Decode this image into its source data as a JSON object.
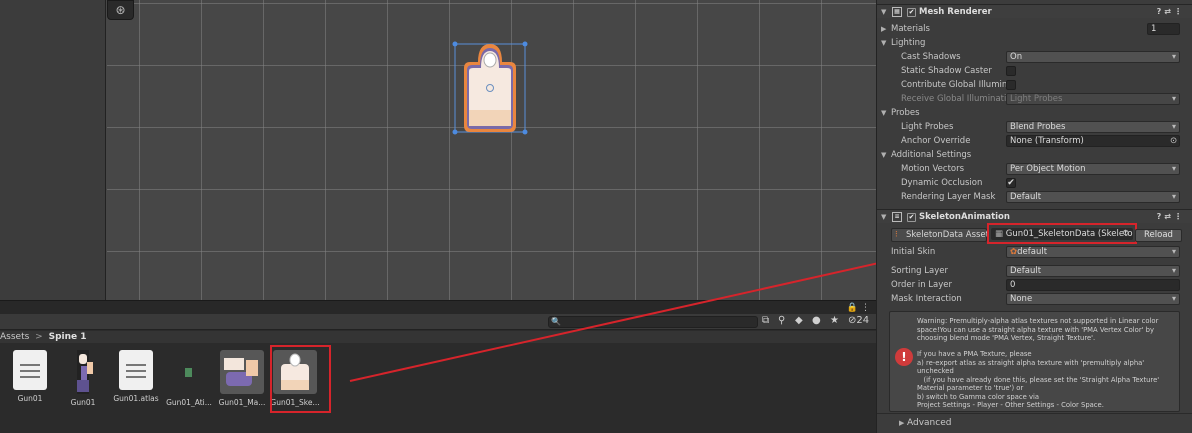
{
  "scene": {
    "gizmo_icon": "globe-grid-icon",
    "panel_icons": "🔒 ⋮"
  },
  "project": {
    "breadcrumb": {
      "root": "Assets",
      "sep": ">",
      "folder": "Spine 1"
    },
    "toolbar": {
      "hidden_count": "24"
    },
    "assets": [
      {
        "label": "Gun01",
        "icon": "text-file-icon"
      },
      {
        "label": "Gun01",
        "icon": "atlas-texture-icon"
      },
      {
        "label": "Gun01.atlas",
        "icon": "text-file-icon"
      },
      {
        "label": "Gun01_Ati...",
        "icon": "atlas-asset-icon"
      },
      {
        "label": "Gun01_Ma...",
        "icon": "material-icon"
      },
      {
        "label": "Gun01_Ske...",
        "icon": "skeleton-data-icon"
      }
    ]
  },
  "inspector": {
    "mesh_renderer": {
      "title": "Mesh Renderer",
      "materials_label": "Materials",
      "materials_count": "1",
      "lighting_label": "Lighting",
      "cast_shadows_label": "Cast Shadows",
      "cast_shadows_value": "On",
      "static_shadow_label": "Static Shadow Caster",
      "contribute_gi_label": "Contribute Global Illuminat",
      "receive_gi_label": "Receive Global Illumination",
      "receive_gi_value": "Light Probes",
      "probes_label": "Probes",
      "light_probes_label": "Light Probes",
      "light_probes_value": "Blend Probes",
      "anchor_label": "Anchor Override",
      "anchor_value": "None (Transform)",
      "additional_label": "Additional Settings",
      "motion_label": "Motion Vectors",
      "motion_value": "Per Object Motion",
      "dynamic_occ_label": "Dynamic Occlusion",
      "dynamic_occ_check": "✔",
      "layer_mask_label": "Rendering Layer Mask",
      "layer_mask_value": "Default"
    },
    "skeleton_animation": {
      "title": "SkeletonAnimation",
      "data_label": "SkeletonData Asset",
      "data_value": "Gun01_SkeletonData (Skeleto",
      "reload": "Reload",
      "initial_skin_label": "Initial Skin",
      "initial_skin_value": "default",
      "sorting_layer_label": "Sorting Layer",
      "sorting_layer_value": "Default",
      "order_label": "Order in Layer",
      "order_value": "0",
      "mask_label": "Mask Interaction",
      "mask_value": "None",
      "warning_1": "Warning: Premultiply-alpha atlas textures not supported in Linear color space!You can use a straight alpha texture with 'PMA Vertex Color' by choosing blend mode 'PMA Vertex, Straight Texture'.",
      "warning_2": "If you have a PMA Texture, please\na) re-export atlas as straight alpha texture with 'premultiply alpha' unchecked\n   (if you have already done this, please set the 'Straight Alpha Texture' Material parameter to 'true') or\nb) switch to Gamma color space via\nProject Settings - Player - Other Settings - Color Space.",
      "advanced": "Advanced"
    }
  },
  "colors": {
    "highlight": "#d6242b",
    "warning_icon": "#cf3b3b"
  }
}
